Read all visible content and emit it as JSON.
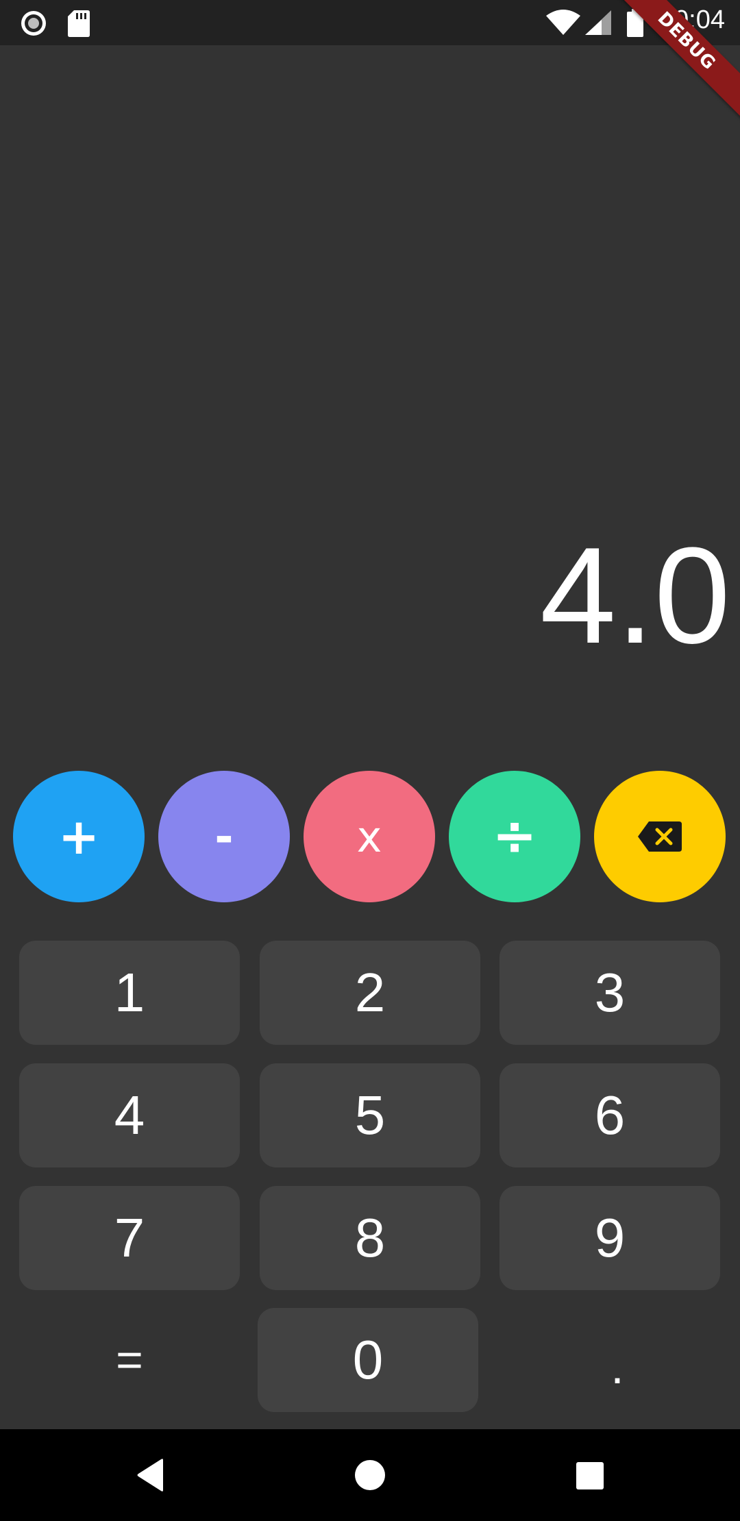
{
  "status_bar": {
    "time": "10:04",
    "icons": [
      "record-icon",
      "sd-card-icon",
      "wifi-icon",
      "signal-icon",
      "battery-icon"
    ]
  },
  "debug_banner": "DEBUG",
  "display": {
    "value": "4.0"
  },
  "operators": [
    {
      "label": "+",
      "name": "add",
      "color": "#1fa2f3"
    },
    {
      "label": "-",
      "name": "subtract",
      "color": "#8785ee"
    },
    {
      "label": "x",
      "name": "multiply",
      "color": "#f26c80"
    },
    {
      "label": "÷",
      "name": "divide",
      "color": "#31d99b"
    },
    {
      "label": "",
      "name": "backspace",
      "icon": "backspace-icon",
      "color": "#fecc00"
    }
  ],
  "keys": {
    "k1": "1",
    "k2": "2",
    "k3": "3",
    "k4": "4",
    "k5": "5",
    "k6": "6",
    "k7": "7",
    "k8": "8",
    "k9": "9",
    "equals": "=",
    "k0": "0",
    "dot": "."
  },
  "nav_bar": {
    "icons": [
      "back-icon",
      "home-icon",
      "recents-icon"
    ]
  },
  "colors": {
    "background": "#333333",
    "key": "#424242",
    "status_bar": "#222222",
    "debug_banner": "#8b1a1a"
  }
}
